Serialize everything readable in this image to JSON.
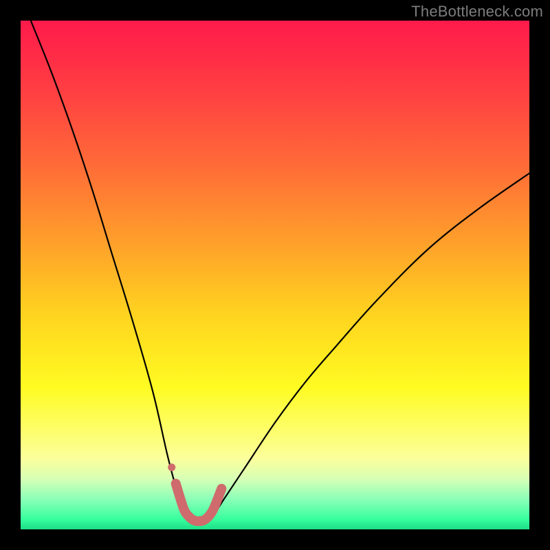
{
  "watermark": "TheBottleneck.com",
  "colors": {
    "frame": "#000000",
    "line_main": "#000000",
    "marker": "#cf6b6c"
  },
  "chart_data": {
    "type": "line",
    "title": "",
    "xlabel": "",
    "ylabel": "",
    "xlim": [
      0,
      100
    ],
    "ylim": [
      0,
      100
    ],
    "series": [
      {
        "name": "bottleneck-curve",
        "x": [
          2,
          6,
          10,
          14,
          18,
          22,
          26,
          29,
          31,
          33,
          34.5,
          36,
          38,
          40,
          44,
          50,
          56,
          62,
          70,
          80,
          90,
          100
        ],
        "y": [
          100,
          90,
          79,
          67,
          54,
          41,
          27,
          14,
          7,
          3,
          1.5,
          1.5,
          3,
          6,
          12,
          21,
          29,
          36,
          45,
          55,
          63,
          70
        ]
      },
      {
        "name": "bottom-markers",
        "x": [
          30.5,
          32.0,
          33.0,
          34.0,
          35.0,
          36.0,
          37.0,
          38.0,
          39.5
        ],
        "y": [
          9.0,
          4.2,
          2.6,
          1.8,
          1.6,
          1.8,
          2.6,
          4.2,
          8.0
        ]
      }
    ]
  }
}
